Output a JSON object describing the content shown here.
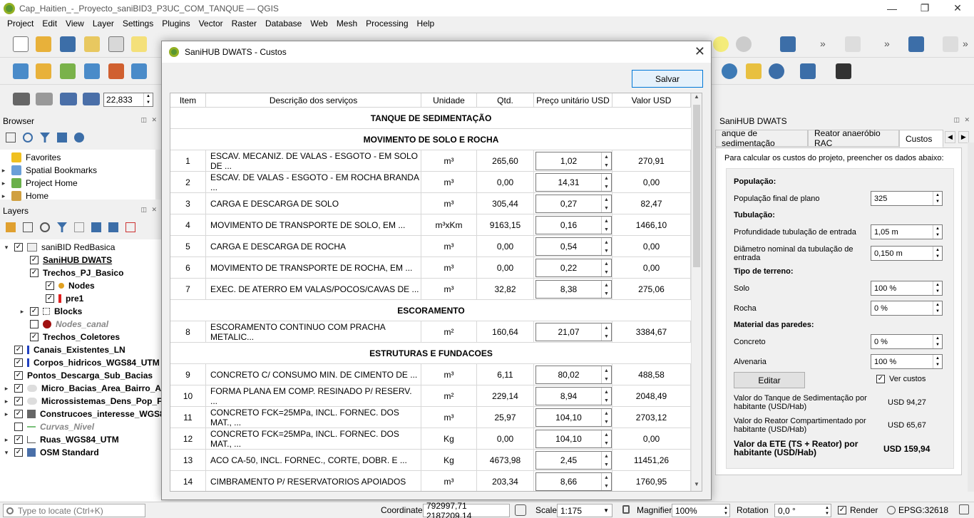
{
  "window": {
    "title": "Cap_Haitien_-_Proyecto_saniBID3_P3UC_COM_TANQUE — QGIS",
    "minimize": "—",
    "maximize": "❐",
    "close": "✕"
  },
  "menu": [
    "Project",
    "Edit",
    "View",
    "Layer",
    "Settings",
    "Plugins",
    "Vector",
    "Raster",
    "Database",
    "Web",
    "Mesh",
    "Processing",
    "Help"
  ],
  "toolbar": {
    "scale_value": "22,833"
  },
  "browser": {
    "title": "Browser",
    "items": [
      "Favorites",
      "Spatial Bookmarks",
      "Project Home",
      "Home"
    ]
  },
  "layers": {
    "title": "Layers",
    "items": [
      {
        "label": "saniBID RedBasica",
        "bold": false,
        "italic": false
      },
      {
        "label": "SaniHUB DWATS",
        "bold": true,
        "italic": false
      },
      {
        "label": "Trechos_PJ_Basico",
        "bold": true,
        "italic": false
      },
      {
        "label": "Nodes",
        "bold": true,
        "italic": false
      },
      {
        "label": "pre1",
        "bold": true,
        "italic": false
      },
      {
        "label": "Blocks",
        "bold": true,
        "italic": false
      },
      {
        "label": "Nodes_canal",
        "bold": true,
        "italic": true
      },
      {
        "label": "Trechos_Coletores",
        "bold": true,
        "italic": false
      },
      {
        "label": "Canais_Existentes_LN",
        "bold": true,
        "italic": false
      },
      {
        "label": "Corpos_hidricos_WGS84_UTM",
        "bold": true,
        "italic": false
      },
      {
        "label": "Pontos_Descarga_Sub_Bacias",
        "bold": true,
        "italic": false
      },
      {
        "label": "Micro_Bacias_Area_Bairro_Alt",
        "bold": true,
        "italic": false
      },
      {
        "label": "Microssistemas_Dens_Pop_Fir",
        "bold": true,
        "italic": false
      },
      {
        "label": "Construcoes_interesse_WGS8",
        "bold": true,
        "italic": false
      },
      {
        "label": "Curvas_Nivel",
        "bold": true,
        "italic": true
      },
      {
        "label": "Ruas_WGS84_UTM",
        "bold": true,
        "italic": false
      },
      {
        "label": "OSM Standard",
        "bold": true,
        "italic": false
      }
    ]
  },
  "dialog": {
    "title": "SaniHUB DWATS - Custos",
    "save_label": "Salvar",
    "headers": [
      "Item",
      "Descrição dos serviços",
      "Unidade",
      "Qtd.",
      "Preço unitário USD",
      "Valor USD"
    ],
    "sections": [
      {
        "title": "TANQUE DE SEDIMENTAÇÃO",
        "rows": []
      },
      {
        "title": "MOVIMENTO DE SOLO E ROCHA",
        "rows": [
          {
            "item": "1",
            "desc": "ESCAV. MECANIZ. DE VALAS - ESGOTO - EM SOLO DE ...",
            "unit": "m³",
            "qty": "265,60",
            "price": "1,02",
            "value": "270,91"
          },
          {
            "item": "2",
            "desc": "ESCAV. DE VALAS - ESGOTO - EM ROCHA BRANDA ...",
            "unit": "m³",
            "qty": "0,00",
            "price": "14,31",
            "value": "0,00"
          },
          {
            "item": "3",
            "desc": "CARGA E DESCARGA DE SOLO",
            "unit": "m³",
            "qty": "305,44",
            "price": "0,27",
            "value": "82,47"
          },
          {
            "item": "4",
            "desc": "MOVIMENTO DE TRANSPORTE DE SOLO, EM ...",
            "unit": "m³xKm",
            "qty": "9163,15",
            "price": "0,16",
            "value": "1466,10"
          },
          {
            "item": "5",
            "desc": "CARGA E DESCARGA DE ROCHA",
            "unit": "m³",
            "qty": "0,00",
            "price": "0,54",
            "value": "0,00"
          },
          {
            "item": "6",
            "desc": "MOVIMENTO DE TRANSPORTE DE ROCHA, EM ...",
            "unit": "m³",
            "qty": "0,00",
            "price": "0,22",
            "value": "0,00"
          },
          {
            "item": "7",
            "desc": "EXEC. DE ATERRO EM VALAS/POCOS/CAVAS DE ...",
            "unit": "m³",
            "qty": "32,82",
            "price": "8,38",
            "value": "275,06"
          }
        ]
      },
      {
        "title": "ESCORAMENTO",
        "rows": [
          {
            "item": "8",
            "desc": "ESCORAMENTO CONTINUO COM PRACHA METALIC...",
            "unit": "m²",
            "qty": "160,64",
            "price": "21,07",
            "value": "3384,67"
          }
        ]
      },
      {
        "title": "ESTRUTURAS E FUNDACOES",
        "rows": [
          {
            "item": "9",
            "desc": "CONCRETO C/ CONSUMO MIN. DE CIMENTO DE ...",
            "unit": "m³",
            "qty": "6,11",
            "price": "80,02",
            "value": "488,58"
          },
          {
            "item": "10",
            "desc": "FORMA PLANA EM COMP. RESINADO P/ RESERV. ...",
            "unit": "m²",
            "qty": "229,14",
            "price": "8,94",
            "value": "2048,49"
          },
          {
            "item": "11",
            "desc": "CONCRETO FCK=25MPa, INCL. FORNEC. DOS  MAT., ...",
            "unit": "m³",
            "qty": "25,97",
            "price": "104,10",
            "value": "2703,12"
          },
          {
            "item": "12",
            "desc": "CONCRETO FCK=25MPa, INCL. FORNEC. DOS  MAT., ...",
            "unit": "Kg",
            "qty": "0,00",
            "price": "104,10",
            "value": "0,00"
          },
          {
            "item": "13",
            "desc": "ACO CA-50, INCL. FORNEC., CORTE, DOBR. E ...",
            "unit": "Kg",
            "qty": "4673,98",
            "price": "2,45",
            "value": "11451,26"
          },
          {
            "item": "14",
            "desc": "CIMBRAMENTO P/ RESERVATORIOS APOIADOS",
            "unit": "m³",
            "qty": "203,34",
            "price": "8,66",
            "value": "1760,95"
          }
        ]
      }
    ]
  },
  "sanihub": {
    "panel_title": "SaniHUB DWATS",
    "tabs": [
      "anque de sedimentação",
      "Reator anaeróbio RAC",
      "Custos"
    ],
    "intro": "Para calcular os custos do projeto, preencher os dados abaixo:",
    "populacao_heading": "População:",
    "populacao_label": "População final de plano",
    "populacao_value": "325",
    "tubulacao_heading": "Tubulação:",
    "profundidade_label": "Profundidade tubulação de entrada",
    "profundidade_value": "1,05 m",
    "diametro_label": "Diâmetro nominal da tubulação de entrada",
    "diametro_value": "0,150 m",
    "terreno_heading": "Tipo de terreno:",
    "solo_label": "Solo",
    "solo_value": "100 %",
    "rocha_label": "Rocha",
    "rocha_value": "0 %",
    "paredes_heading": "Material das paredes:",
    "concreto_label": "Concreto",
    "concreto_value": "0 %",
    "alvenaria_label": "Alvenaria",
    "alvenaria_value": "100 %",
    "editar_label": "Editar",
    "ver_custos_label": "Ver custos",
    "tanque_label": "Valor do Tanque de Sedimentação por habitante (USD/Hab)",
    "tanque_value": "USD 94,27",
    "reator_label": "Valor do Reator Compartimentado por habitante (USD/Hab)",
    "reator_value": "USD 65,67",
    "ete_label": "Valor da ETE (TS + Reator) por habitante (USD/Hab)",
    "ete_value": "USD 159,94"
  },
  "status": {
    "locate_placeholder": "Type to locate (Ctrl+K)",
    "coordinate_label": "Coordinate",
    "coordinate_value": "792997,71 2187209,14",
    "scale_label": "Scale",
    "scale_value": "1:175",
    "magnifier_label": "Magnifier",
    "magnifier_value": "100%",
    "rotation_label": "Rotation",
    "rotation_value": "0,0 °",
    "render_label": "Render",
    "crs_label": "EPSG:32618"
  }
}
